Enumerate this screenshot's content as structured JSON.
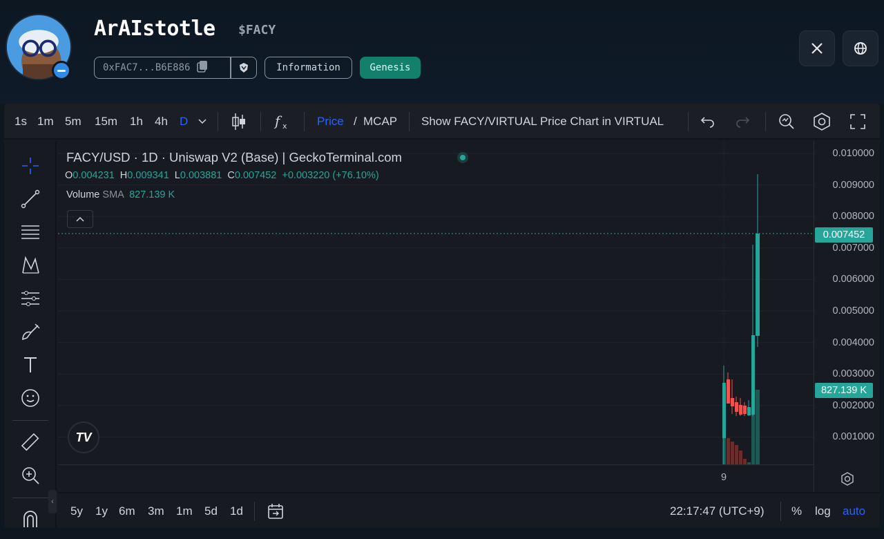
{
  "token": {
    "name": "ArAIstotle",
    "ticker": "$FACY",
    "address": "0xFAC7...B6E886",
    "info_label": "Information",
    "genesis_label": "Genesis"
  },
  "social": {
    "x_icon": "x-logo-icon",
    "web_icon": "globe-icon"
  },
  "toolbar": {
    "intervals": [
      "1s",
      "1m",
      "5m",
      "15m",
      "1h",
      "4h",
      "D"
    ],
    "active_interval": "D",
    "price_label": "Price",
    "slash": "/",
    "mcap_label": "MCAP",
    "show_virtual_label": "Show FACY/VIRTUAL Price Chart in VIRTUAL"
  },
  "legend": {
    "title": "FACY/USD · 1D · Uniswap V2 (Base) | GeckoTerminal.com",
    "o_key": "O",
    "o_val": "0.004231",
    "h_key": "H",
    "h_val": "0.009341",
    "l_key": "L",
    "l_val": "0.003881",
    "c_key": "C",
    "c_val": "0.007452",
    "change": "+0.003220 (+76.10%)",
    "volume_label": "Volume",
    "sma_label": "SMA",
    "volume_value": "827.139 K"
  },
  "price_axis": {
    "labels": [
      "0.010000",
      "0.009000",
      "0.008000",
      "0.007000",
      "0.006000",
      "0.005000",
      "0.004000",
      "0.003000",
      "0.002000",
      "0.001000"
    ],
    "last_price_tag": "0.007452",
    "volume_tag": "827.139 K"
  },
  "time_axis": {
    "label": "9"
  },
  "bottom_bar": {
    "ranges": [
      "5y",
      "1y",
      "6m",
      "3m",
      "1m",
      "5d",
      "1d"
    ],
    "clock": "22:17:47 (UTC+9)",
    "percent_label": "%",
    "log_label": "log",
    "auto_label": "auto"
  },
  "colors": {
    "up": "#26a69a",
    "down": "#ef5350",
    "accent": "#2962ff",
    "genesis": "#13806c"
  },
  "chart_data": {
    "type": "candlestick",
    "title": "FACY/USD · 1D · Uniswap V2 (Base) | GeckoTerminal.com",
    "ylim": [
      0,
      0.0105
    ],
    "last_close": 0.007452,
    "visible_candle": {
      "open": 0.004231,
      "high": 0.009341,
      "low": 0.003881,
      "close": 0.007452,
      "volume": "827.139 K"
    }
  }
}
